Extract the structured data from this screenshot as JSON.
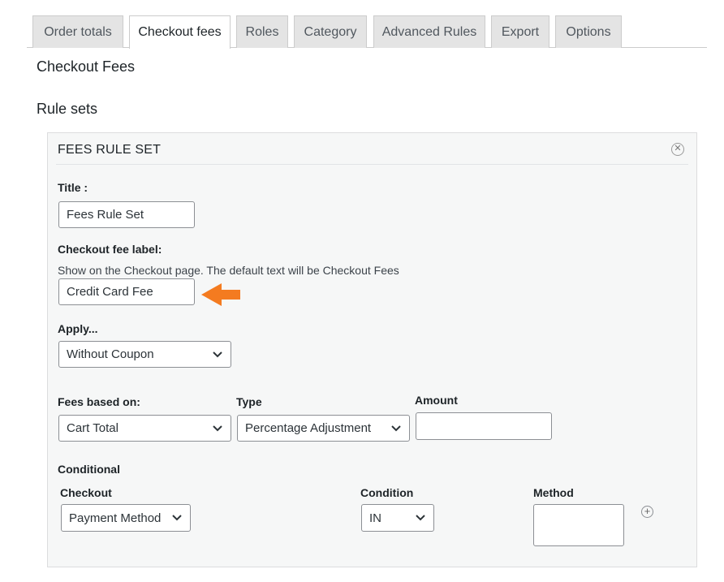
{
  "tabs": [
    {
      "label": "Order totals",
      "active": false
    },
    {
      "label": "Checkout fees",
      "active": true
    },
    {
      "label": "Roles",
      "active": false
    },
    {
      "label": "Category",
      "active": false
    },
    {
      "label": "Advanced Rules",
      "active": false
    },
    {
      "label": "Export",
      "active": false
    },
    {
      "label": "Options",
      "active": false
    }
  ],
  "page_title": "Checkout Fees",
  "section_title": "Rule sets",
  "rule_set": {
    "title": "FEES RULE SET",
    "close_icon": "close-icon",
    "title_field": {
      "label": "Title :",
      "value": "Fees Rule Set"
    },
    "fee_label_field": {
      "label": "Checkout fee label:",
      "description": "Show on the Checkout page. The default text will be Checkout Fees",
      "value": "Credit Card Fee"
    },
    "apply": {
      "label": "Apply...",
      "selected": "Without Coupon"
    },
    "fees_based_on": {
      "label": "Fees based on:",
      "selected": "Cart Total"
    },
    "type": {
      "label": "Type",
      "selected": "Percentage Adjustment"
    },
    "amount": {
      "label": "Amount",
      "value": ""
    },
    "conditional": {
      "label": "Conditional",
      "checkout": {
        "label": "Checkout",
        "selected": "Payment Method"
      },
      "condition": {
        "label": "Condition",
        "selected": "IN"
      },
      "method": {
        "label": "Method",
        "value": ""
      }
    }
  },
  "annotation_arrow_color": "#f47b20"
}
